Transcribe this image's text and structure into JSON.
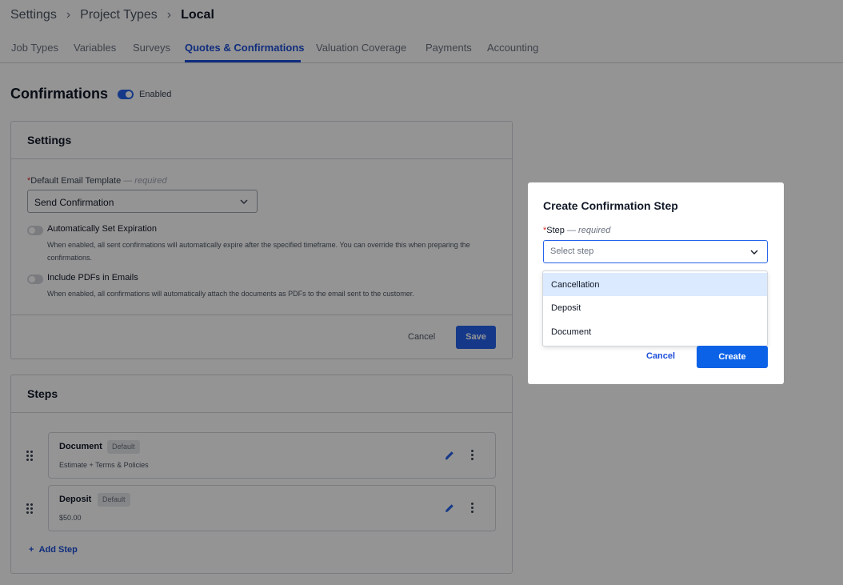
{
  "breadcrumb": {
    "items": [
      "Settings",
      "Project Types",
      "Local"
    ]
  },
  "tabs": [
    {
      "label": "Job Types"
    },
    {
      "label": "Variables"
    },
    {
      "label": "Surveys"
    },
    {
      "label": "Quotes & Confirmations",
      "active": true
    },
    {
      "label": "Valuation Coverage"
    },
    {
      "label": "Payments"
    },
    {
      "label": "Accounting"
    }
  ],
  "confirmations": {
    "title": "Confirmations",
    "enabled_label": "Enabled"
  },
  "settings": {
    "heading": "Settings",
    "template_label": "Default Email Template",
    "required_label": "— required",
    "template_value": "Send Confirmation",
    "expiration_title": "Automatically Set Expiration",
    "expiration_desc": "When enabled, all sent confirmations will automatically expire after the specified timeframe. You can override this when preparing the confirmations.",
    "pdf_title": "Include PDFs in Emails",
    "pdf_desc": "When enabled, all confirmations will automatically attach the documents as PDFs to the email sent to the customer.",
    "cancel_label": "Cancel",
    "save_label": "Save"
  },
  "steps": {
    "heading": "Steps",
    "items": [
      {
        "title": "Document",
        "badge": "Default",
        "subtitle": "Estimate + Terms & Policies"
      },
      {
        "title": "Deposit",
        "badge": "Default",
        "subtitle": "$50.00"
      }
    ],
    "add_label": "Add Step"
  },
  "modal": {
    "title": "Create Confirmation Step",
    "step_label": "Step",
    "required_label": "— required",
    "placeholder": "Select step",
    "options": [
      "Cancellation",
      "Deposit",
      "Document"
    ],
    "cancel_label": "Cancel",
    "create_label": "Create"
  },
  "colors": {
    "accent": "#1d4ed8",
    "primary_button": "#0b62e6",
    "highlight": "#dbeafe"
  }
}
